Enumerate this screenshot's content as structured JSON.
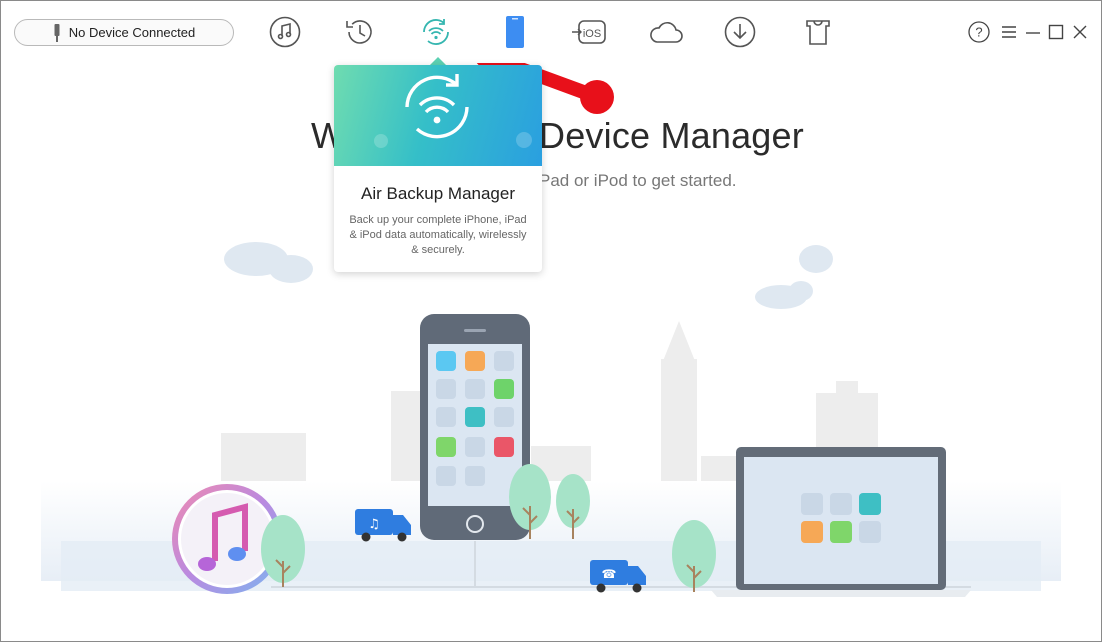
{
  "device": {
    "status": "No Device Connected"
  },
  "toolbar": {
    "items": [
      {
        "name": "audio-manager-icon"
      },
      {
        "name": "backup-history-icon"
      },
      {
        "name": "air-backup-icon"
      },
      {
        "name": "device-manager-icon"
      },
      {
        "name": "ios-mover-icon"
      },
      {
        "name": "icloud-manager-icon"
      },
      {
        "name": "downloader-icon"
      },
      {
        "name": "ringtone-maker-icon"
      }
    ]
  },
  "window_controls": {
    "help": "?"
  },
  "welcome": {
    "title_left": "W",
    "title_right": "Device Manager",
    "subtitle": "Pad or iPod to get started."
  },
  "tooltip": {
    "title": "Air Backup Manager",
    "description": "Back up your complete iPhone, iPad & iPod data automatically, wirelessly & securely."
  },
  "colors": {
    "accent_teal": "#35bfc8",
    "accent_blue": "#2a9fe0",
    "arrow_red": "#e8101a",
    "active_icon": "#35b6b0"
  }
}
